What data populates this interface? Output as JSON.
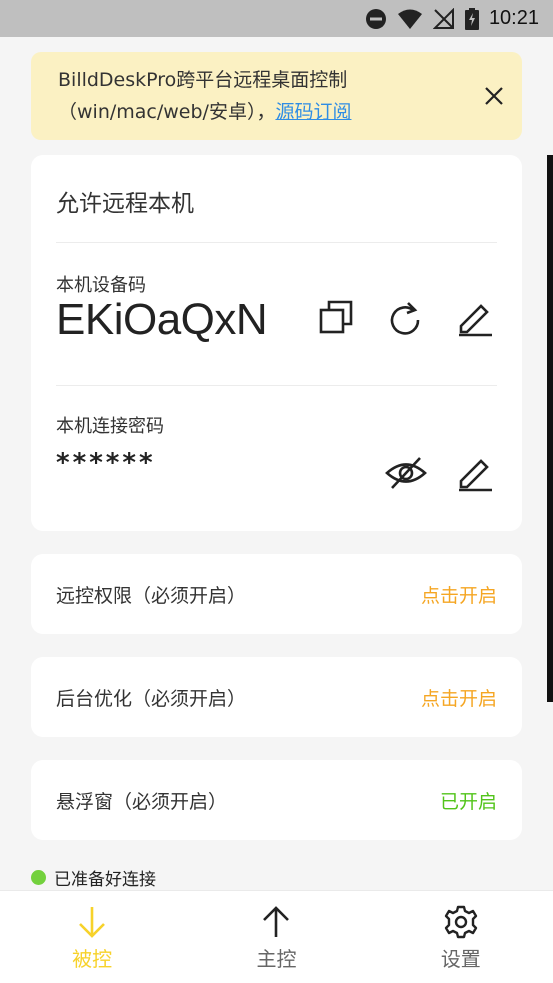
{
  "status_bar": {
    "time": "10:21"
  },
  "banner": {
    "text": "BilldDeskPro跨平台远程桌面控制（win/mac/web/安卓），",
    "link_label": "源码订阅"
  },
  "remote_card": {
    "title": "允许远程本机",
    "device_code_label": "本机设备码",
    "device_code": "EKiOaQxN",
    "password_label": "本机连接密码",
    "password_masked": "******"
  },
  "permissions": [
    {
      "label": "远控权限（必须开启）",
      "action": "点击开启",
      "enabled": false
    },
    {
      "label": "后台优化（必须开启）",
      "action": "点击开启",
      "enabled": false
    },
    {
      "label": "悬浮窗（必须开启）",
      "action": "已开启",
      "enabled": true
    }
  ],
  "connection_status": "已准备好连接",
  "tabs": [
    {
      "label": "被控",
      "icon": "arrow-down-icon",
      "active": true
    },
    {
      "label": "主控",
      "icon": "arrow-up-icon",
      "active": false
    },
    {
      "label": "设置",
      "icon": "gear-icon",
      "active": false
    }
  ],
  "colors": {
    "accent": "#f7d22a",
    "warning": "#f5a623",
    "success": "#52c41a",
    "banner_bg": "#fbf1c3",
    "link": "#2f8de4"
  }
}
